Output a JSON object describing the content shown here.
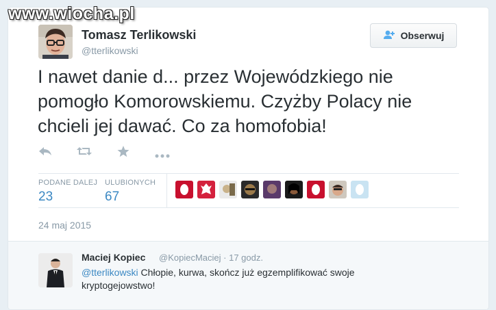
{
  "watermark": "www.wiocha.pl",
  "tweet": {
    "author_name": "Tomasz Terlikowski",
    "author_handle": "@tterlikowski",
    "follow_label": "Obserwuj",
    "text": "I nawet danie d... przez Wojewódzkiego nie pomogło Komorowskiemu. Czyżby Polacy nie chcieli jej dawać. Co za homofobia!",
    "actions": {
      "reply_icon": "reply-icon",
      "retweet_icon": "retweet-icon",
      "favorite_icon": "star-icon",
      "more_icon": "more-icon"
    },
    "stats": {
      "retweets_label": "PODANE DALEJ",
      "retweets_count": "23",
      "favorites_label": "ULUBIONYCH",
      "favorites_count": "67"
    },
    "date": "24 maj 2015"
  },
  "reply": {
    "author_name": "Maciej Kopiec",
    "author_handle": "@KopiecMaciej",
    "time": "17 godz.",
    "mention": "@tterlikowski",
    "text": " Chłopie, kurwa, skończ już egzemplifikować swoje kryptogejowstwo!"
  },
  "colors": {
    "link": "#3b88c3",
    "muted": "#8899a6",
    "text": "#292f33",
    "background": "#e8eff4"
  }
}
